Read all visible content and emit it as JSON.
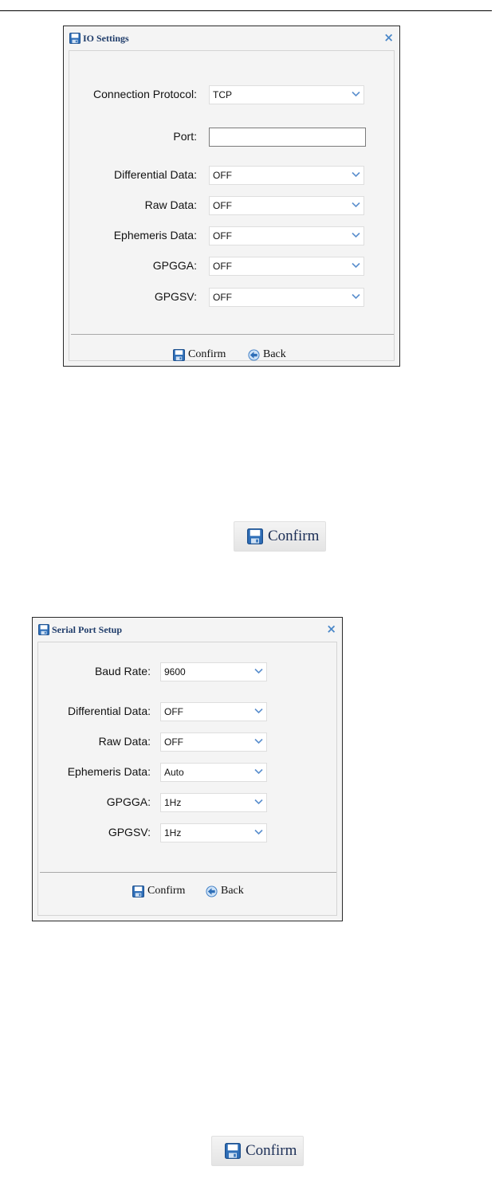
{
  "io_dialog": {
    "title": "IO Settings",
    "close": "×",
    "fields": [
      {
        "label": "Connection Protocol:",
        "type": "select",
        "value": "TCP"
      },
      {
        "label": "Port:",
        "type": "text",
        "value": ""
      },
      {
        "label": "Differential Data:",
        "type": "select",
        "value": "OFF"
      },
      {
        "label": "Raw Data:",
        "type": "select",
        "value": "OFF"
      },
      {
        "label": "Ephemeris Data:",
        "type": "select",
        "value": "OFF"
      },
      {
        "label": "GPGGA:",
        "type": "select",
        "value": "OFF"
      },
      {
        "label": "GPGSV:",
        "type": "select",
        "value": "OFF"
      }
    ],
    "confirm_label": "Confirm",
    "back_label": "Back"
  },
  "confirm_callout_1": {
    "label": "Confirm"
  },
  "serial_dialog": {
    "title": "Serial Port Setup",
    "close": "×",
    "fields": [
      {
        "label": "Baud Rate:",
        "type": "select",
        "value": "9600"
      },
      {
        "label": "Differential Data:",
        "type": "select",
        "value": "OFF"
      },
      {
        "label": "Raw Data:",
        "type": "select",
        "value": "OFF"
      },
      {
        "label": "Ephemeris Data:",
        "type": "select",
        "value": "Auto"
      },
      {
        "label": "GPGGA:",
        "type": "select",
        "value": "1Hz"
      },
      {
        "label": "GPGSV:",
        "type": "select",
        "value": "1Hz"
      }
    ],
    "confirm_label": "Confirm",
    "back_label": "Back"
  },
  "confirm_callout_2": {
    "label": "Confirm"
  },
  "colors": {
    "accent": "#4a87c8",
    "title_text": "#1f3c6a",
    "dialog_bg": "#f4f4f4"
  }
}
